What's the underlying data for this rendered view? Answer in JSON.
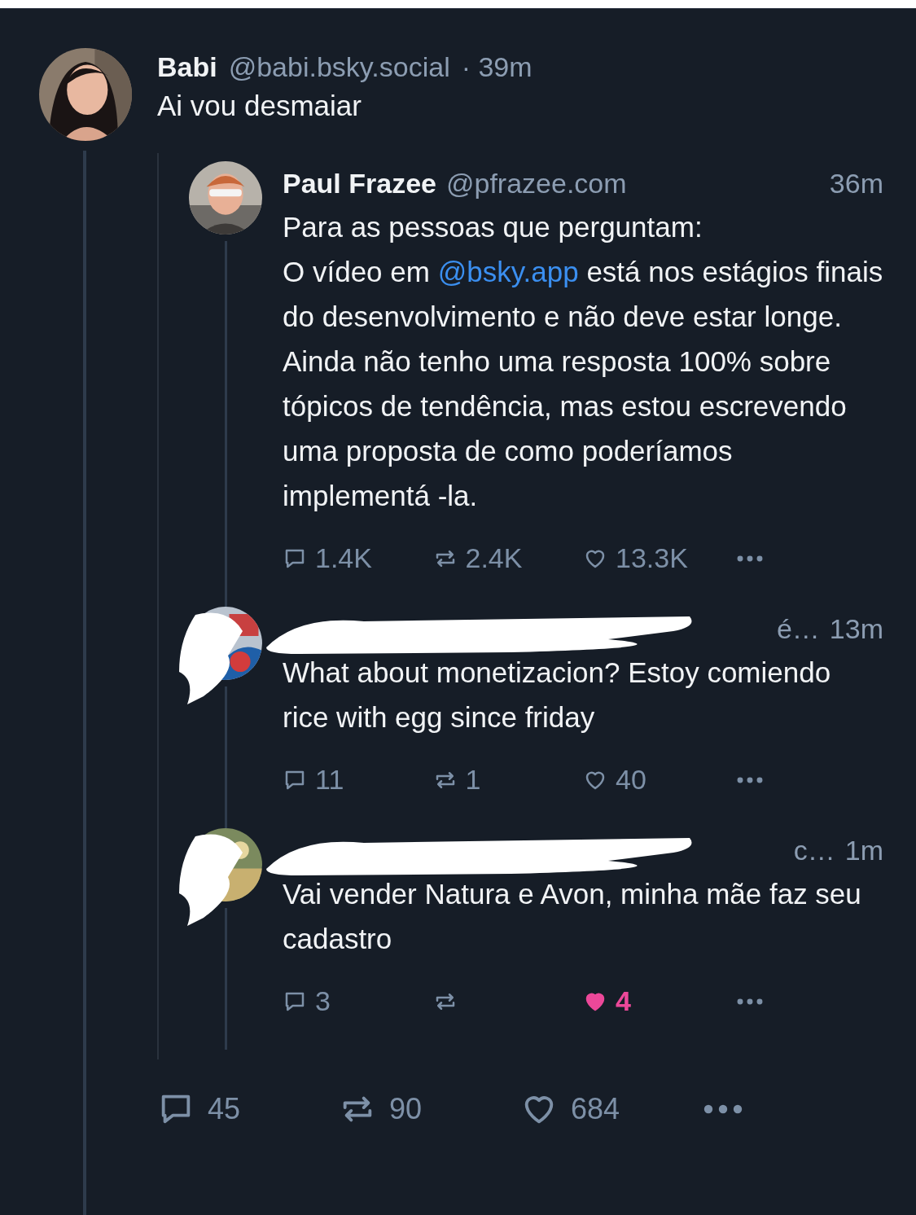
{
  "post": {
    "author": {
      "name": "Babi",
      "handle": "@babi.bsky.social"
    },
    "time": "· 39m",
    "text": "Ai vou desmaiar",
    "thread": [
      {
        "kind": "post",
        "author": {
          "name": "Paul Frazee",
          "handle": "@pfrazee.com"
        },
        "time": "36m",
        "text": [
          {
            "kind": "text",
            "text": "Para as pessoas que perguntam:\nO vídeo em "
          },
          {
            "kind": "mention",
            "text": "@bsky.app"
          },
          {
            "kind": "text",
            "text": " está nos estágios finais do desenvolvimento e não deve estar longe. Ainda não tenho uma resposta 100% sobre tópicos de tendência, mas estou escrevendo uma proposta de como poderíamos implementá -la."
          }
        ],
        "stats": {
          "replies": "1.4K",
          "reposts": "2.4K",
          "likes": "13.3K",
          "liked": false
        }
      },
      {
        "kind": "redacted",
        "handle_tail": "é…",
        "time": "13m",
        "text": [
          {
            "kind": "text",
            "text": "What about monetizacion? Estoy comiendo rice with egg since friday"
          }
        ],
        "stats": {
          "replies": "11",
          "reposts": "1",
          "likes": "40",
          "liked": false
        }
      },
      {
        "kind": "redacted",
        "handle_tail": "c…",
        "time": "1m",
        "text": [
          {
            "kind": "text",
            "text": "Vai vender Natura e Avon, minha mãe faz seu cadastro"
          }
        ],
        "stats": {
          "replies": "3",
          "likes": "4",
          "liked": true
        }
      }
    ],
    "stats": {
      "replies": "45",
      "reposts": "90",
      "likes": "684",
      "liked": false
    }
  }
}
